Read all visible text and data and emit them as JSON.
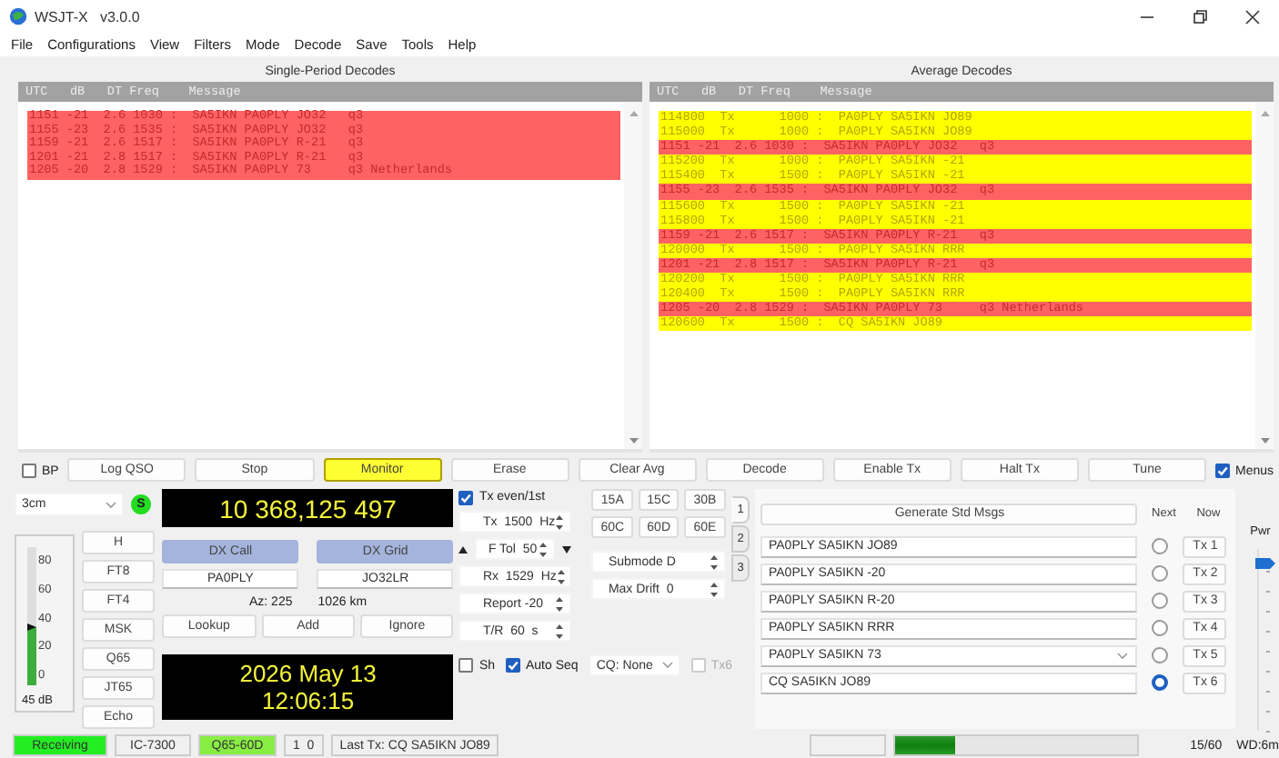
{
  "window": {
    "title": "WSJT-X   v3.0.0"
  },
  "menu": [
    "File",
    "Configurations",
    "View",
    "Filters",
    "Mode",
    "Decode",
    "Save",
    "Tools",
    "Help"
  ],
  "panels": [
    {
      "title": "Single-Period Decodes",
      "header": "UTC   dB   DT Freq    Message",
      "lines": [
        {
          "kind": "decode",
          "text": "1151 -21  2.6 1030 :  SA5IKN PA0PLY JO32   q3"
        },
        {
          "kind": "decode",
          "text": "1155 -23  2.6 1535 :  SA5IKN PA0PLY JO32   q3"
        },
        {
          "kind": "decode",
          "text": "1159 -21  2.6 1517 :  SA5IKN PA0PLY R-21   q3"
        },
        {
          "kind": "decode",
          "text": "1201 -21  2.8 1517 :  SA5IKN PA0PLY R-21   q3"
        },
        {
          "kind": "decode",
          "text": "1205 -20  2.8 1529 :  SA5IKN PA0PLY 73     q3 Netherlands"
        }
      ]
    },
    {
      "title": "Average Decodes",
      "header": "UTC   dB   DT Freq    Message",
      "lines": [
        {
          "kind": "tx",
          "text": "114800  Tx      1000 :  PA0PLY SA5IKN JO89"
        },
        {
          "kind": "tx",
          "text": "115000  Tx      1000 :  PA0PLY SA5IKN JO89"
        },
        {
          "kind": "decode",
          "text": "1151 -21  2.6 1030 :  SA5IKN PA0PLY JO32   q3"
        },
        {
          "kind": "tx",
          "text": "115200  Tx      1000 :  PA0PLY SA5IKN -21"
        },
        {
          "kind": "tx",
          "text": "115400  Tx      1500 :  PA0PLY SA5IKN -21"
        },
        {
          "kind": "decode",
          "text": "1155 -23  2.6 1535 :  SA5IKN PA0PLY JO32   q3"
        },
        {
          "kind": "tx",
          "text": "115600  Tx      1500 :  PA0PLY SA5IKN -21"
        },
        {
          "kind": "tx",
          "text": "115800  Tx      1500 :  PA0PLY SA5IKN -21"
        },
        {
          "kind": "decode",
          "text": "1159 -21  2.6 1517 :  SA5IKN PA0PLY R-21   q3"
        },
        {
          "kind": "tx",
          "text": "120000  Tx      1500 :  PA0PLY SA5IKN RRR"
        },
        {
          "kind": "decode",
          "text": "1201 -21  2.8 1517 :  SA5IKN PA0PLY R-21   q3"
        },
        {
          "kind": "tx",
          "text": "120200  Tx      1500 :  PA0PLY SA5IKN RRR"
        },
        {
          "kind": "tx",
          "text": "120400  Tx      1500 :  PA0PLY SA5IKN RRR"
        },
        {
          "kind": "decode",
          "text": "1205 -20  2.8 1529 :  SA5IKN PA0PLY 73     q3 Netherlands"
        },
        {
          "kind": "tx",
          "text": "120600  Tx      1500 :  CQ SA5IKN JO89"
        }
      ]
    }
  ],
  "button_bar": [
    {
      "kind": "checkbox",
      "label": "BP",
      "checked": false
    },
    {
      "kind": "button",
      "label": "Log QSO",
      "on": false
    },
    {
      "kind": "button",
      "label": "Stop",
      "on": false
    },
    {
      "kind": "button",
      "label": "Monitor",
      "on": true
    },
    {
      "kind": "button",
      "label": "Erase",
      "on": false
    },
    {
      "kind": "button",
      "label": "Clear Avg",
      "on": false
    },
    {
      "kind": "button",
      "label": "Decode",
      "on": false
    },
    {
      "kind": "button",
      "label": "Enable Tx",
      "on": false
    },
    {
      "kind": "button",
      "label": "Halt Tx",
      "on": false
    },
    {
      "kind": "button",
      "label": "Tune",
      "on": false
    },
    {
      "kind": "checkbox",
      "label": "Menus",
      "checked": true
    }
  ],
  "band": {
    "value": "3cm",
    "indicator": "S"
  },
  "meter": {
    "ticks": [
      "80",
      "60",
      "40",
      "20",
      "0"
    ],
    "level": 0.42,
    "reading": "45 dB"
  },
  "modes": [
    "H",
    "FT8",
    "FT4",
    "MSK",
    "Q65",
    "JT65",
    "Echo"
  ],
  "frequency": "10 368,125 497",
  "dx": {
    "call_label": "DX Call",
    "grid_label": "DX Grid",
    "call": "PA0PLY",
    "grid": "JO32LR",
    "azimuth": "Az: 225",
    "distance": "1026 km",
    "buttons": [
      "Lookup",
      "Add",
      "Ignore"
    ]
  },
  "clock": {
    "date": "2026 May 13",
    "time": "12:06:15"
  },
  "tx_even": {
    "label": "Tx even/1st",
    "checked": true
  },
  "settings": [
    {
      "kind": "spin",
      "text": "Tx  1500  Hz"
    },
    {
      "kind": "ftol",
      "text": "F Tol  50"
    },
    {
      "kind": "spin",
      "text": "Rx  1529  Hz"
    },
    {
      "kind": "spin",
      "text": "Report -20"
    },
    {
      "kind": "spin",
      "text": "T/R  60  s"
    }
  ],
  "options": [
    {
      "kind": "checkbox",
      "label": "Sh",
      "checked": false,
      "disabled": false
    },
    {
      "kind": "checkbox",
      "label": "Auto Seq",
      "checked": true,
      "disabled": false
    },
    {
      "kind": "combo",
      "value": "CQ: None"
    },
    {
      "kind": "checkbox",
      "label": "Tx6",
      "checked": false,
      "disabled": true
    }
  ],
  "submodes": [
    "15A",
    "15C",
    "30B",
    "60C",
    "60D",
    "60E"
  ],
  "submode_spins": [
    "Submode D",
    "Max Drift  0"
  ],
  "tabs": [
    {
      "label": "1",
      "selected": true
    },
    {
      "label": "2",
      "selected": false
    },
    {
      "label": "3",
      "selected": false
    }
  ],
  "messages": {
    "generate": "Generate Std Msgs",
    "next_label": "Next",
    "now_label": "Now",
    "rows": [
      {
        "kind": "field",
        "text": "PA0PLY SA5IKN JO89",
        "selected": false,
        "button": "Tx 1"
      },
      {
        "kind": "field",
        "text": "PA0PLY SA5IKN -20",
        "selected": false,
        "button": "Tx 2"
      },
      {
        "kind": "field",
        "text": "PA0PLY SA5IKN R-20",
        "selected": false,
        "button": "Tx 3"
      },
      {
        "kind": "field",
        "text": "PA0PLY SA5IKN RRR",
        "selected": false,
        "button": "Tx 4"
      },
      {
        "kind": "combo",
        "text": "PA0PLY SA5IKN 73",
        "selected": false,
        "button": "Tx 5"
      },
      {
        "kind": "field",
        "text": "CQ SA5IKN JO89",
        "selected": true,
        "button": "Tx 6"
      }
    ]
  },
  "power": {
    "label": "Pwr",
    "level": 0.95
  },
  "status_bar": [
    {
      "text": "Receiving",
      "color": "#22ee22"
    },
    {
      "text": "IC-7300",
      "color": "#f0f0f0"
    },
    {
      "text": "Q65-60D",
      "color": "#88ee44"
    },
    {
      "text": "1  0",
      "color": "#f0f0f0"
    },
    {
      "text": "Last Tx: CQ SA5IKN JO89",
      "color": "#f0f0f0"
    }
  ],
  "progress": {
    "level": 0.25,
    "reading": "15/60"
  },
  "watchdog": "WD:6m"
}
